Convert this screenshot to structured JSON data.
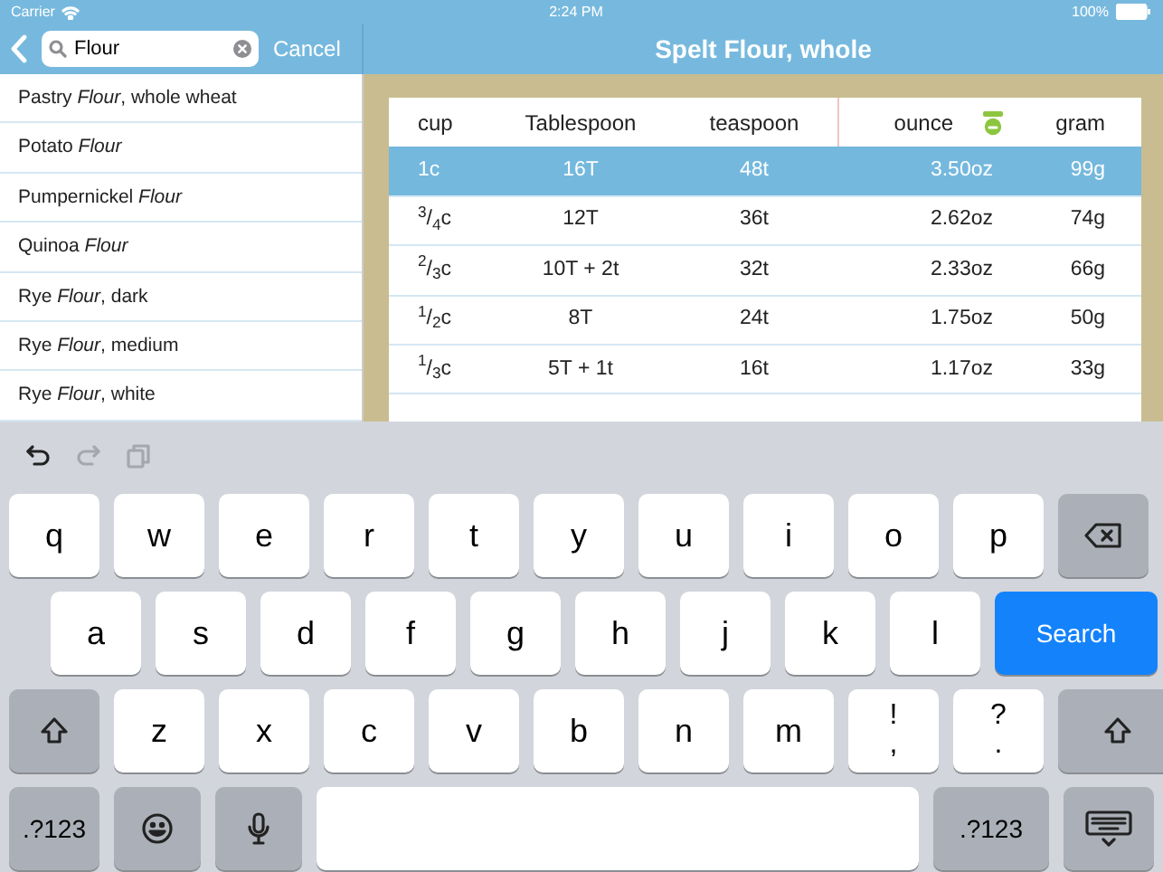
{
  "status_bar": {
    "carrier": "Carrier",
    "time": "2:24 PM",
    "battery": "100%"
  },
  "search": {
    "value": "Flour",
    "cancel": "Cancel"
  },
  "title": "Spelt Flour, whole",
  "results": [
    {
      "label": "Pastry *Flour*, whole wheat"
    },
    {
      "label": "Potato *Flour*"
    },
    {
      "label": "Pumpernickel *Flour*"
    },
    {
      "label": "Quinoa *Flour*"
    },
    {
      "label": "Rye *Flour*, dark"
    },
    {
      "label": "Rye *Flour*, medium"
    },
    {
      "label": "Rye *Flour*, white"
    }
  ],
  "table": {
    "columns": [
      "cup",
      "Tablespoon",
      "teaspoon",
      "ounce",
      "gram"
    ],
    "rows": [
      {
        "cells": [
          "1c",
          "16T",
          "48t",
          "3.50oz",
          "99g"
        ],
        "selected": true
      },
      {
        "cells": [
          "$^{3}$/$_{4}$c",
          "12T",
          "36t",
          "2.62oz",
          "74g"
        ],
        "selected": false
      },
      {
        "cells": [
          "$^{2}$/$_{3}$c",
          "10T + 2t",
          "32t",
          "2.33oz",
          "66g"
        ],
        "selected": false
      },
      {
        "cells": [
          "$^{1}$/$_{2}$c",
          "8T",
          "24t",
          "1.75oz",
          "50g"
        ],
        "selected": false
      },
      {
        "cells": [
          "$^{1}$/$_{3}$c",
          "5T + 1t",
          "16t",
          "1.17oz",
          "33g"
        ],
        "selected": false
      }
    ]
  },
  "keyboard": {
    "toolbar": [
      {
        "kind": "undo",
        "disabled": false
      },
      {
        "kind": "redo",
        "disabled": true
      },
      {
        "kind": "paste",
        "disabled": true
      }
    ],
    "rows": [
      {
        "keys": [
          {
            "kind": "letter",
            "label": "q"
          },
          {
            "kind": "letter",
            "label": "w"
          },
          {
            "kind": "letter",
            "label": "e"
          },
          {
            "kind": "letter",
            "label": "r"
          },
          {
            "kind": "letter",
            "label": "t"
          },
          {
            "kind": "letter",
            "label": "y"
          },
          {
            "kind": "letter",
            "label": "u"
          },
          {
            "kind": "letter",
            "label": "i"
          },
          {
            "kind": "letter",
            "label": "o"
          },
          {
            "kind": "letter",
            "label": "p"
          },
          {
            "kind": "backspace"
          }
        ]
      },
      {
        "keys": [
          {
            "kind": "letter",
            "label": "a"
          },
          {
            "kind": "letter",
            "label": "s"
          },
          {
            "kind": "letter",
            "label": "d"
          },
          {
            "kind": "letter",
            "label": "f"
          },
          {
            "kind": "letter",
            "label": "g"
          },
          {
            "kind": "letter",
            "label": "h"
          },
          {
            "kind": "letter",
            "label": "j"
          },
          {
            "kind": "letter",
            "label": "k"
          },
          {
            "kind": "letter",
            "label": "l"
          },
          {
            "kind": "search",
            "label": "Search"
          }
        ]
      },
      {
        "keys": [
          {
            "kind": "shift"
          },
          {
            "kind": "letter",
            "label": "z"
          },
          {
            "kind": "letter",
            "label": "x"
          },
          {
            "kind": "letter",
            "label": "c"
          },
          {
            "kind": "letter",
            "label": "v"
          },
          {
            "kind": "letter",
            "label": "b"
          },
          {
            "kind": "letter",
            "label": "n"
          },
          {
            "kind": "letter",
            "label": "m"
          },
          {
            "kind": "punct",
            "top": "!",
            "bottom": ","
          },
          {
            "kind": "punct",
            "top": "?",
            "bottom": "."
          },
          {
            "kind": "shift"
          }
        ]
      },
      {
        "keys": [
          {
            "kind": "numbers",
            "label": ".?123"
          },
          {
            "kind": "emoji"
          },
          {
            "kind": "mic"
          },
          {
            "kind": "space"
          },
          {
            "kind": "numbers",
            "label": ".?123"
          },
          {
            "kind": "hide"
          }
        ]
      }
    ]
  }
}
